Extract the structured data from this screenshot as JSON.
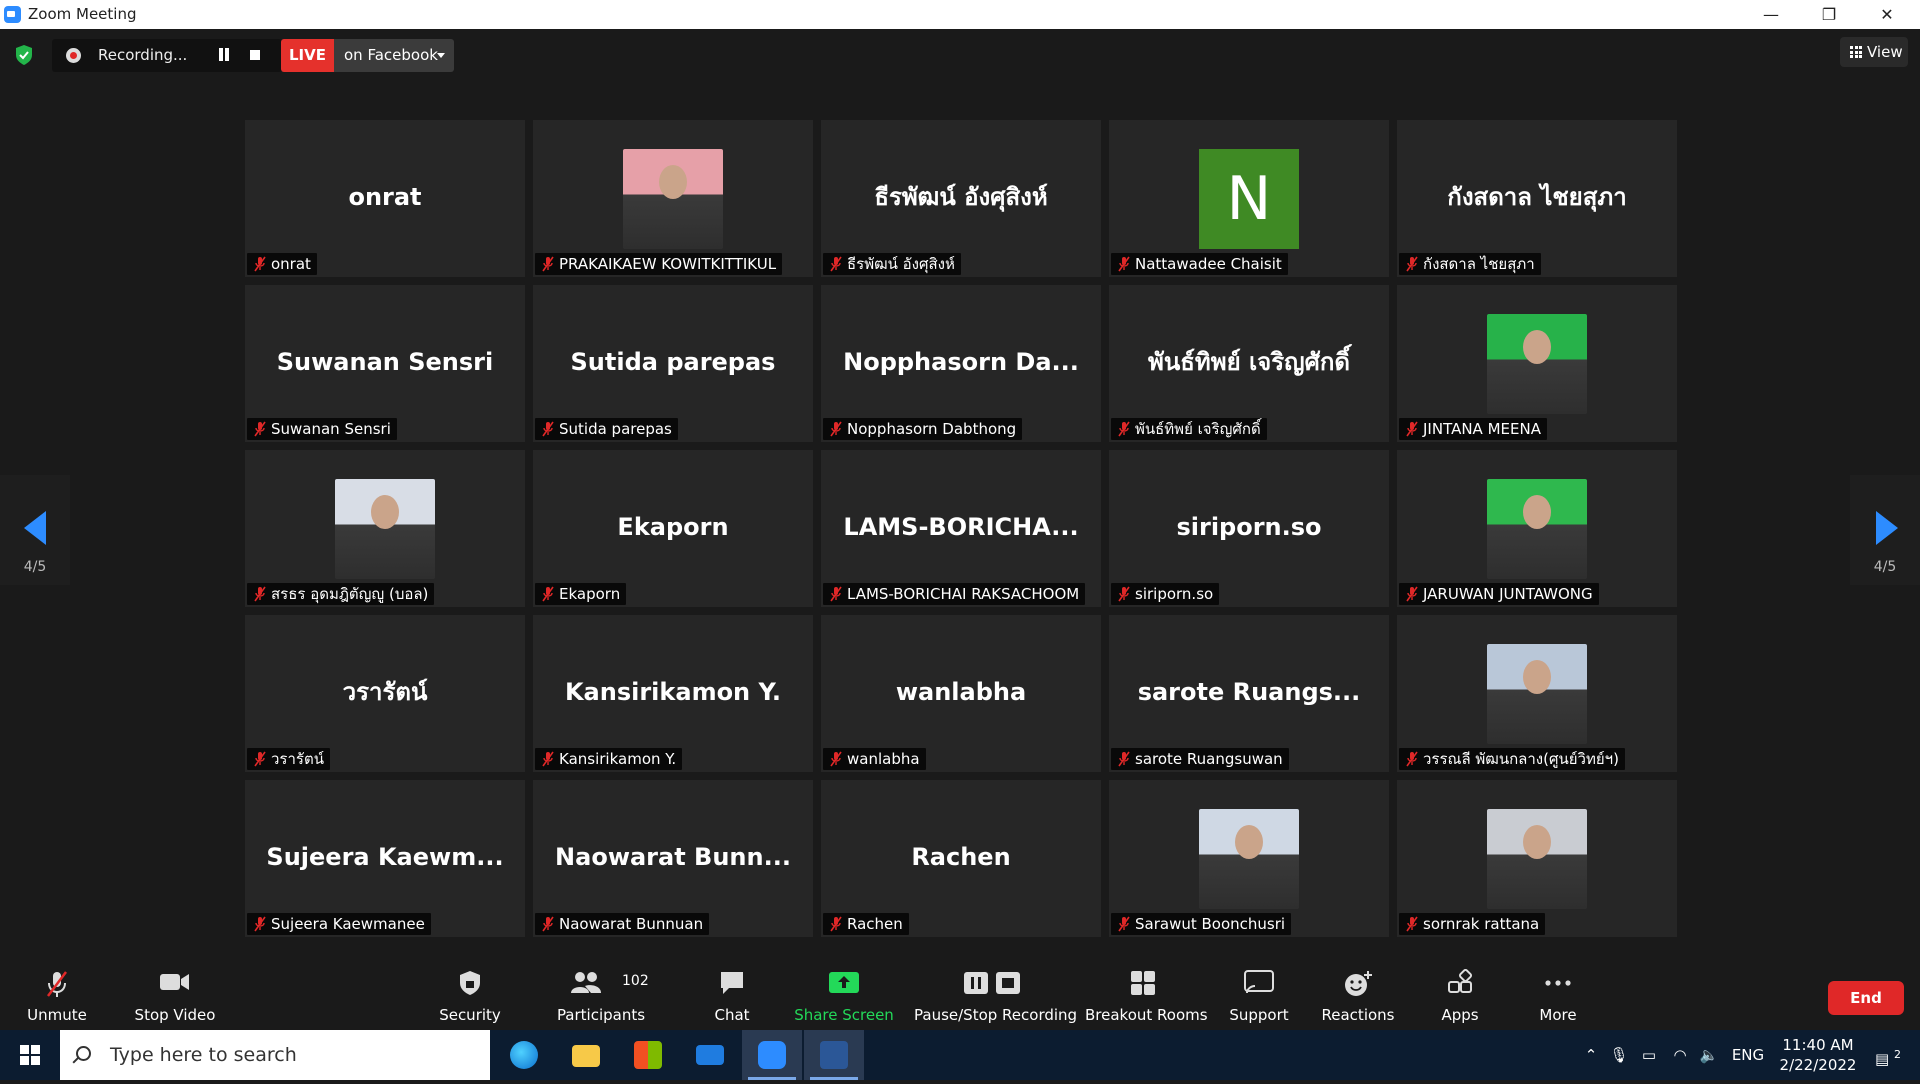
{
  "window": {
    "title": "Zoom Meeting",
    "controls": [
      "—",
      "❐",
      "✕"
    ]
  },
  "meeting_bar": {
    "recording_label": "Recording...",
    "live_badge": "LIVE",
    "live_destination": "on Facebook",
    "view_label": "View"
  },
  "pagination": {
    "left": "4/5",
    "right": "4/5"
  },
  "participants": [
    {
      "display": "onrat",
      "label": "onrat",
      "type": "name"
    },
    {
      "display": "",
      "label": "PRAKAIKAEW KOWITKITTIKUL",
      "type": "photo",
      "photo_color": "#e6a0a8"
    },
    {
      "display": "ธีรพัฒน์ อังศุสิงห์",
      "label": "ธีรพัฒน์ อังศุสิงห์",
      "type": "name"
    },
    {
      "display": "N",
      "label": "Nattawadee Chaisit",
      "type": "letter"
    },
    {
      "display": "กังสดาล ไชยสุภา",
      "label": "กังสดาล ไชยสุภา",
      "type": "name"
    },
    {
      "display": "Suwanan Sensri",
      "label": "Suwanan Sensri",
      "type": "name"
    },
    {
      "display": "Sutida parepas",
      "label": "Sutida parepas",
      "type": "name"
    },
    {
      "display": "Nopphasorn Da...",
      "label": "Nopphasorn Dabthong",
      "type": "name"
    },
    {
      "display": "พันธ์ทิพย์ เจริญศักดิ์",
      "label": "พันธ์ทิพย์ เจริญศักดิ์",
      "type": "name"
    },
    {
      "display": "",
      "label": "JINTANA MEENA",
      "type": "photo",
      "photo_color": "#27b24a"
    },
    {
      "display": "",
      "label": "สรธร อุดมฎิตัญญู (บอล)",
      "type": "photo",
      "photo_color": "#d8dde6"
    },
    {
      "display": "Ekaporn",
      "label": "Ekaporn",
      "type": "name"
    },
    {
      "display": "LAMS-BORICHA...",
      "label": "LAMS-BORICHAI RAKSACHOOM",
      "type": "name"
    },
    {
      "display": "siriporn.so",
      "label": "siriporn.so",
      "type": "name"
    },
    {
      "display": "",
      "label": "JARUWAN JUNTAWONG",
      "type": "photo",
      "photo_color": "#2fb84e"
    },
    {
      "display": "วรารัตน์",
      "label": "วรารัตน์",
      "type": "name"
    },
    {
      "display": "Kansirikamon Y.",
      "label": "Kansirikamon Y.",
      "type": "name"
    },
    {
      "display": "wanlabha",
      "label": "wanlabha",
      "type": "name"
    },
    {
      "display": "sarote   Ruangs...",
      "label": "sarote   Ruangsuwan",
      "type": "name"
    },
    {
      "display": "",
      "label": "วรรณลี พัฒนกลาง(ศูนย์วิทย์ฯ)",
      "type": "photo",
      "photo_color": "#b9c7d8"
    },
    {
      "display": "Sujeera  Kaewm...",
      "label": "Sujeera Kaewmanee",
      "type": "name"
    },
    {
      "display": "Naowarat Bunn...",
      "label": "Naowarat Bunnuan",
      "type": "name"
    },
    {
      "display": "Rachen",
      "label": "Rachen",
      "type": "name"
    },
    {
      "display": "",
      "label": "Sarawut Boonchusri",
      "type": "photo",
      "photo_color": "#cfd8e4"
    },
    {
      "display": "",
      "label": "sornrak rattana",
      "type": "photo",
      "photo_color": "#c9ccd2"
    }
  ],
  "toolbar": {
    "unmute": "Unmute",
    "stop_video": "Stop Video",
    "security": "Security",
    "participants": "Participants",
    "participants_count": "102",
    "chat": "Chat",
    "share_screen": "Share Screen",
    "pause_stop_recording": "Pause/Stop Recording",
    "breakout_rooms": "Breakout Rooms",
    "support": "Support",
    "reactions": "Reactions",
    "apps": "Apps",
    "more": "More",
    "end": "End"
  },
  "colors": {
    "accent": "#2d8cff",
    "live": "#e5312c",
    "end": "#e02828",
    "share": "#23d959",
    "muted_mic": "#e02828"
  },
  "taskbar": {
    "search_placeholder": "Type here to search",
    "language": "ENG",
    "time": "11:40 AM",
    "date": "2/22/2022",
    "notifications": "2"
  }
}
